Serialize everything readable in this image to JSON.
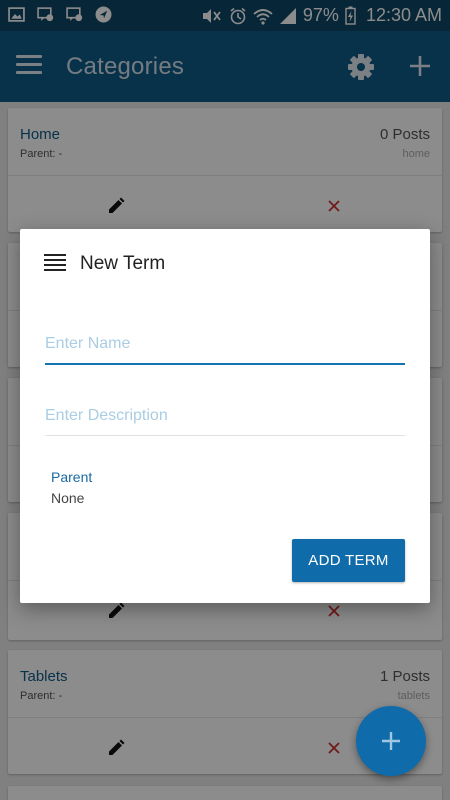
{
  "status_bar": {
    "battery": "97%",
    "time": "12:30 AM",
    "left_icons": [
      "image-icon",
      "chat-icon",
      "chat-icon",
      "navigation-icon"
    ],
    "right_icons": [
      "mute-icon",
      "alarm-icon",
      "wifi-icon",
      "signal-icon",
      "battery-charging-icon"
    ]
  },
  "app_bar": {
    "title": "Categories",
    "icons": [
      "menu-icon",
      "gear-icon",
      "plus-icon"
    ]
  },
  "categories": [
    {
      "name": "Home",
      "parent": "Parent: -",
      "posts": "0 Posts",
      "slug": "home"
    },
    {
      "name": "",
      "parent": "",
      "posts": "",
      "slug": ""
    },
    {
      "name": "",
      "parent": "",
      "posts": "",
      "slug": ""
    },
    {
      "name": "",
      "parent": "",
      "posts": "",
      "slug": ""
    },
    {
      "name": "Tablets",
      "parent": "Parent: -",
      "posts": "1 Posts",
      "slug": "tablets"
    }
  ],
  "dialog": {
    "title": "New Term",
    "name_placeholder": "Enter Name",
    "description_placeholder": "Enter Description",
    "parent_label": "Parent",
    "parent_value": "None",
    "add_button": "ADD TERM"
  },
  "colors": {
    "status_bar": "#0d4767",
    "app_bar": "#0f5a88",
    "accent": "#0f6ba9",
    "delete": "#d32f2f"
  },
  "fab": {
    "icon": "plus-icon"
  }
}
